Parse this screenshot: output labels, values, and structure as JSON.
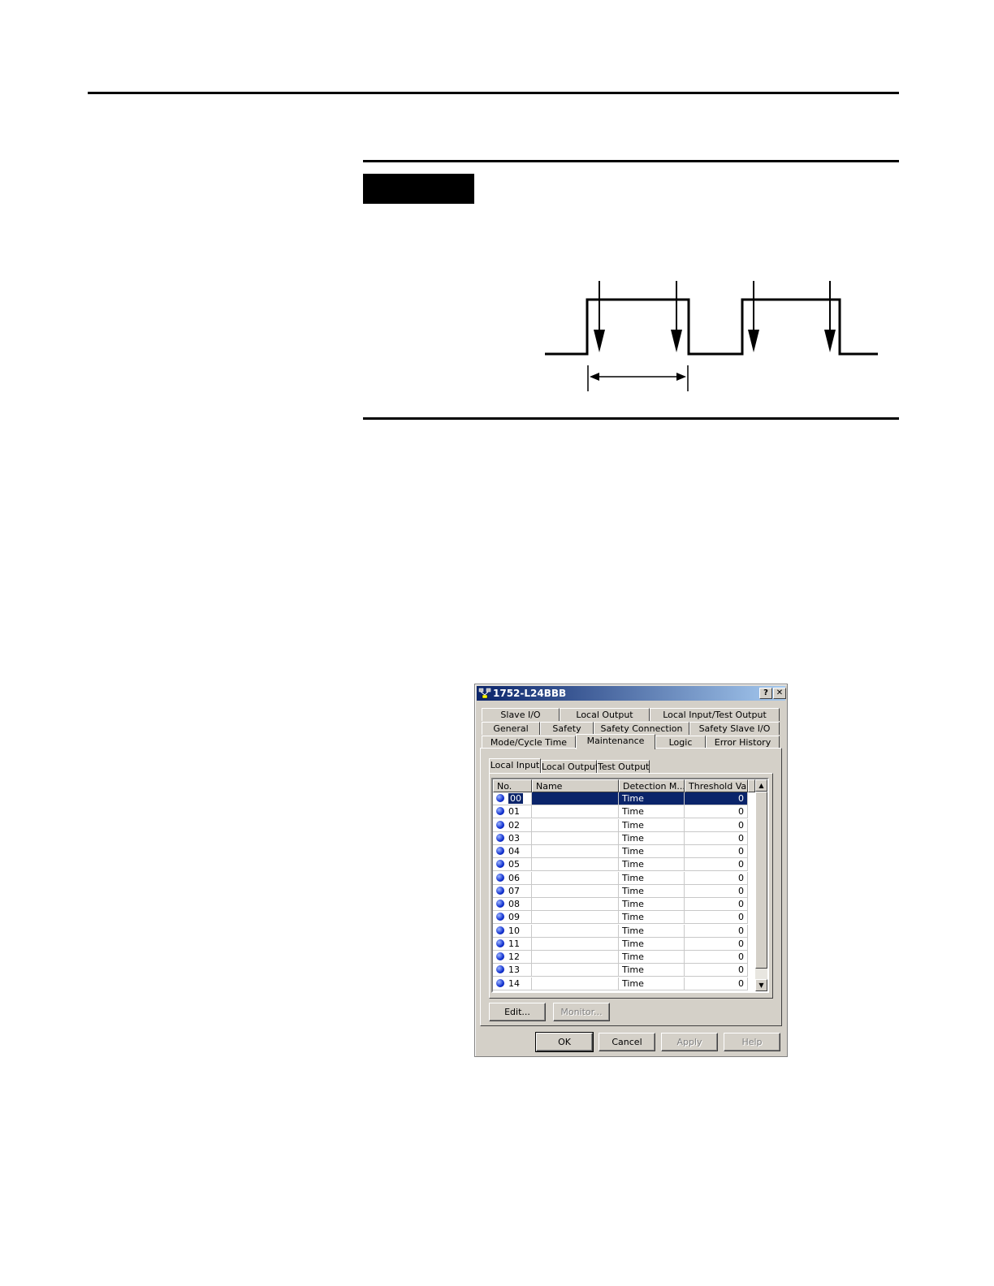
{
  "dialog": {
    "title": "1752-L24BBB",
    "help_glyph": "?",
    "close_glyph": "✕",
    "tabs_row1": [
      "Slave I/O",
      "Local Output",
      "Local Input/Test Output"
    ],
    "tabs_row2": [
      "General",
      "Safety",
      "Safety Connection",
      "Safety Slave I/O"
    ],
    "tabs_row3": [
      "Mode/Cycle Time",
      "Maintenance",
      "Logic",
      "Error History"
    ],
    "selected_tab": "Maintenance",
    "subtabs": [
      "Local Input",
      "Local Output",
      "Test Output"
    ],
    "selected_subtab": "Local Input",
    "columns": [
      "No.",
      "Name",
      "Detection M...",
      "Threshold Va..."
    ],
    "rows": [
      {
        "no": "00",
        "name": "",
        "detection": "Time",
        "threshold": "0"
      },
      {
        "no": "01",
        "name": "",
        "detection": "Time",
        "threshold": "0"
      },
      {
        "no": "02",
        "name": "",
        "detection": "Time",
        "threshold": "0"
      },
      {
        "no": "03",
        "name": "",
        "detection": "Time",
        "threshold": "0"
      },
      {
        "no": "04",
        "name": "",
        "detection": "Time",
        "threshold": "0"
      },
      {
        "no": "05",
        "name": "",
        "detection": "Time",
        "threshold": "0"
      },
      {
        "no": "06",
        "name": "",
        "detection": "Time",
        "threshold": "0"
      },
      {
        "no": "07",
        "name": "",
        "detection": "Time",
        "threshold": "0"
      },
      {
        "no": "08",
        "name": "",
        "detection": "Time",
        "threshold": "0"
      },
      {
        "no": "09",
        "name": "",
        "detection": "Time",
        "threshold": "0"
      },
      {
        "no": "10",
        "name": "",
        "detection": "Time",
        "threshold": "0"
      },
      {
        "no": "11",
        "name": "",
        "detection": "Time",
        "threshold": "0"
      },
      {
        "no": "12",
        "name": "",
        "detection": "Time",
        "threshold": "0"
      },
      {
        "no": "13",
        "name": "",
        "detection": "Time",
        "threshold": "0"
      },
      {
        "no": "14",
        "name": "",
        "detection": "Time",
        "threshold": "0"
      }
    ],
    "selected_row": "00",
    "edit_label": "Edit...",
    "monitor_label": "Monitor...",
    "ok_label": "OK",
    "cancel_label": "Cancel",
    "apply_label": "Apply",
    "help_label": "Help",
    "scroll_up_glyph": "▲",
    "scroll_down_glyph": "▼"
  }
}
